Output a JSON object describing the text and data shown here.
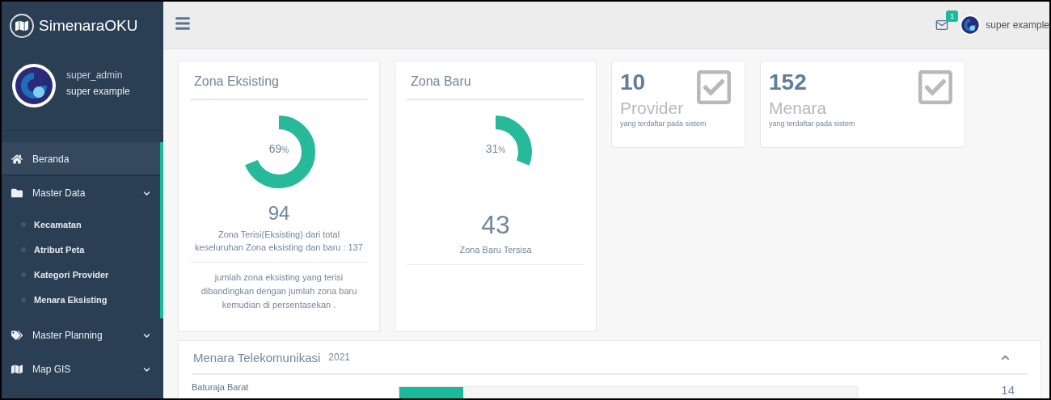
{
  "brand": {
    "title": "SimenaraOKU"
  },
  "profile": {
    "role": "super_admin",
    "name": "super example"
  },
  "sidebar": {
    "items": [
      {
        "label": "Beranda",
        "selected": true,
        "expanded": false
      },
      {
        "label": "Master Data",
        "selected": false,
        "expanded": true,
        "children": [
          {
            "label": "Kecamatan"
          },
          {
            "label": "Atribut Peta"
          },
          {
            "label": "Kategori Provider"
          },
          {
            "label": "Menara Eksisting"
          }
        ]
      },
      {
        "label": "Master Planning",
        "selected": false,
        "expanded": false
      },
      {
        "label": "Map GIS",
        "selected": false,
        "expanded": false
      }
    ]
  },
  "topbar": {
    "mail_count": "1",
    "user": "super example"
  },
  "gauges": [
    {
      "title": "Zona Eksisting",
      "level": 0.69,
      "percent": "69",
      "unit": "%",
      "value": "94",
      "caption": "Zona Terisi(Eksisting) dari total keseluruhan Zona eksisting dan baru : 137",
      "note": "jumlah zona eksisting yang terisi dibandingkan dengan jumlah zona baru kemudian di persentasekan ."
    },
    {
      "title": "Zona Baru",
      "level": 0.31,
      "percent": "31",
      "unit": "%",
      "value": "43",
      "caption": "Zona Baru Tersisa"
    }
  ],
  "stats": [
    {
      "count": "10",
      "label": "Provider",
      "sub": "yang terdaftar pada sistem"
    },
    {
      "count": "152",
      "label": "Menara",
      "sub": "yang terdaftar pada sistem"
    }
  ],
  "panel": {
    "title": "Menara Telekomunikasi",
    "year": "2021",
    "expanded": true,
    "rows": [
      {
        "label": "Baturaja Barat",
        "level": 0.14,
        "value": "14"
      }
    ]
  }
}
